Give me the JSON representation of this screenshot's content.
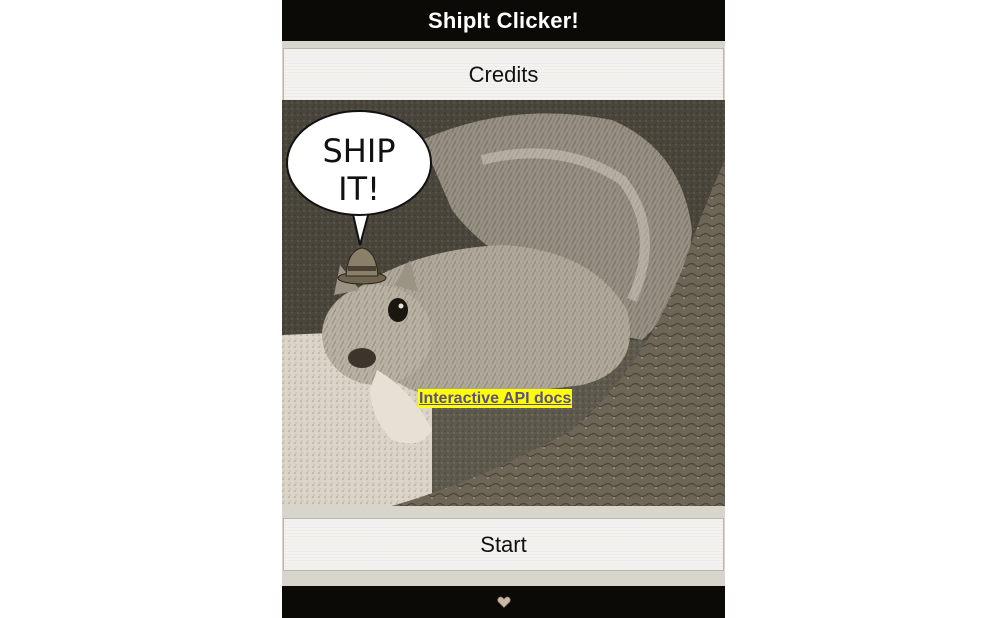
{
  "header": {
    "title": "ShipIt Clicker!"
  },
  "nav": {
    "credits_label": "Credits",
    "start_label": "Start"
  },
  "hero": {
    "speech_line1": "SHIP",
    "speech_line2": "IT!",
    "api_link_label": "Interactive API docs"
  },
  "footer": {
    "icon": "heart-icon"
  },
  "colors": {
    "header_bg": "#0c0a06",
    "page_bg": "#d8d5cc",
    "link_highlight": "#ffff00",
    "link_text": "#5b4f8a"
  }
}
